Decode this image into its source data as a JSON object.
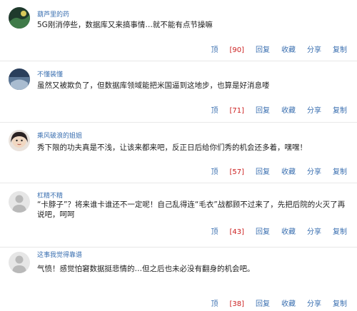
{
  "comments": [
    {
      "username": "葫芦里的药",
      "content": "5G刚消停些，数据库又来搞事情…就不能有点节操嘛",
      "up_label": "顶",
      "up_count": "[90]",
      "reply_label": "回复",
      "collect_label": "收藏",
      "share_label": "分享",
      "copy_label": "复制"
    },
    {
      "username": "不懂装懂",
      "content": "虽然又被欺负了，但数据库领域能把米国逼到这地步，也算是好消息喽",
      "up_label": "顶",
      "up_count": "[71]",
      "reply_label": "回复",
      "collect_label": "收藏",
      "share_label": "分享",
      "copy_label": "复制"
    },
    {
      "username": "乘风破浪的姐姐",
      "content": "秀下限的功夫真是不浅，让该来都来吧，反正日后给你们秀的机会还多着，嘿嘿！",
      "up_label": "顶",
      "up_count": "[57]",
      "reply_label": "回复",
      "collect_label": "收藏",
      "share_label": "分享",
      "copy_label": "复制"
    },
    {
      "username": "杠精不精",
      "content": "“卡脖子”？将来谁卡谁还不一定呢！自己乱得连“毛衣”战都顾不过来了，先把后院的火灭了再说吧，呵呵",
      "up_label": "顶",
      "up_count": "[43]",
      "reply_label": "回复",
      "collect_label": "收藏",
      "share_label": "分享",
      "copy_label": "复制"
    },
    {
      "username": "这事我觉得靠谱",
      "content": "气愤！感觉怕窘数据挺悲情的…但之后也未必没有翻身的机会吧。",
      "up_label": "顶",
      "up_count": "[38]",
      "reply_label": "回复",
      "collect_label": "收藏",
      "share_label": "分享",
      "copy_label": "复制"
    }
  ]
}
